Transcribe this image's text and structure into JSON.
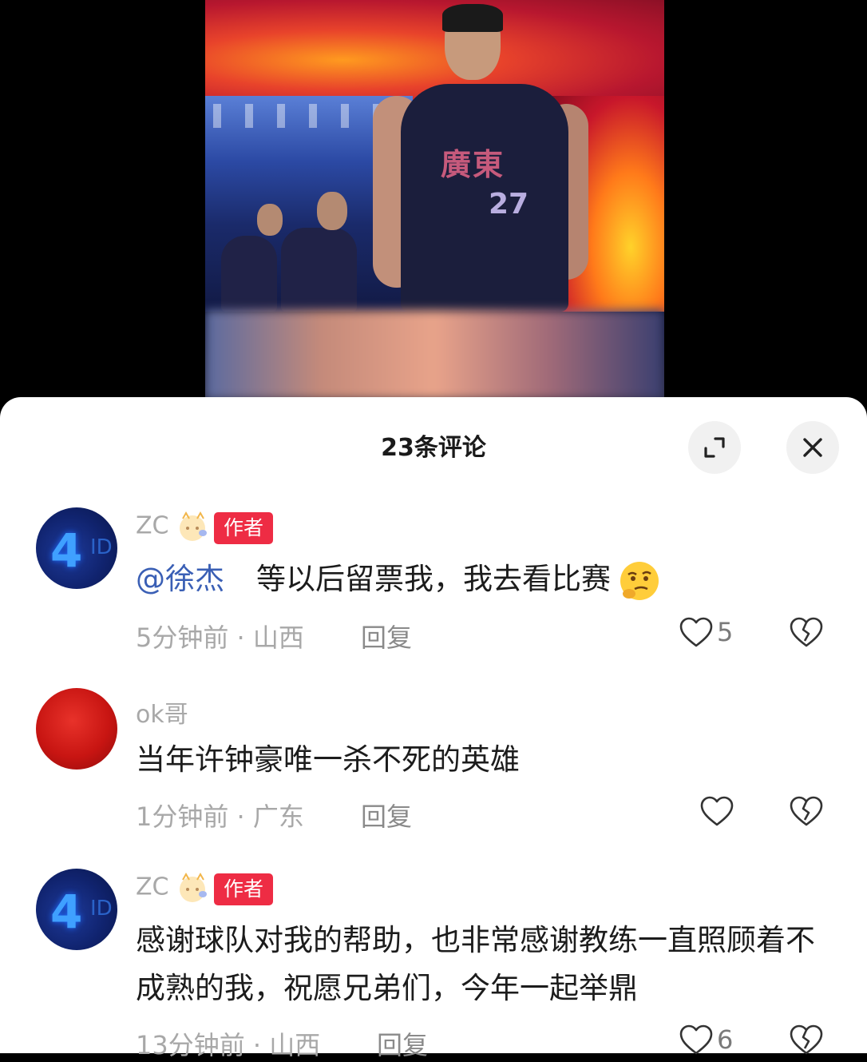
{
  "sheet": {
    "title": "23条评论"
  },
  "comments": [
    {
      "user": "ZC",
      "avatar_text": "4",
      "author_tag": "作者",
      "mention": "@徐杰",
      "text": "等以后留票我，我去看比赛",
      "time": "5分钟前",
      "location": "山西",
      "reply": "回复",
      "likes": "5"
    },
    {
      "user": "ok哥",
      "text": "当年许钟豪唯一杀不死的英雄",
      "time": "1分钟前",
      "location": "广东",
      "reply": "回复",
      "likes": ""
    },
    {
      "user": "ZC",
      "avatar_text": "4",
      "author_tag": "作者",
      "text": "感谢球队对我的帮助，也非常感谢教练一直照顾着不成熟的我，祝愿兄弟们，今年一起举鼎",
      "time": "13分钟前",
      "location": "山西",
      "reply": "回复",
      "likes": "6"
    }
  ],
  "photo": {
    "jersey_text": "廣東",
    "jersey_number": "27"
  },
  "icons": {
    "expand": "expand-icon",
    "close": "close-icon",
    "like": "heart-icon",
    "dislike": "broken-heart-icon"
  },
  "colors": {
    "author_tag": "#ee2c44",
    "mention": "#3a5fb5"
  }
}
